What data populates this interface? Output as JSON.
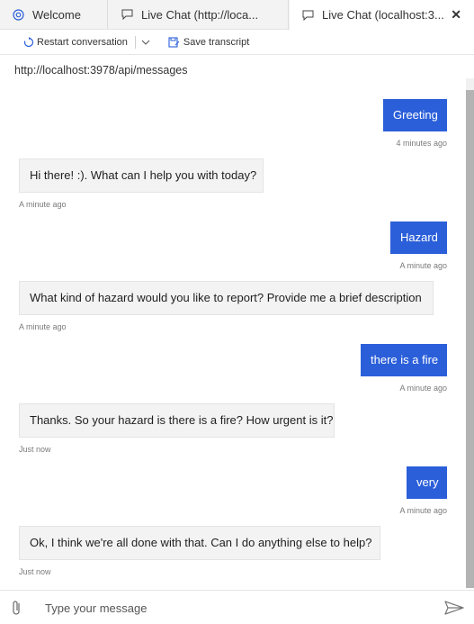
{
  "tabs": [
    {
      "label": "Welcome",
      "icon": "emulator-icon"
    },
    {
      "label": "Live Chat (http://loca...",
      "icon": "chat-icon"
    },
    {
      "label": "Live Chat (localhost:3...",
      "icon": "chat-icon",
      "active": true
    }
  ],
  "toolbar": {
    "restart_label": "Restart conversation",
    "save_label": "Save transcript"
  },
  "endpoint": "http://localhost:3978/api/messages",
  "messages": [
    {
      "from": "user",
      "text": "Greeting",
      "time": "4 minutes ago"
    },
    {
      "from": "bot",
      "text": "Hi there! :). What can I help you with today?",
      "time": "A minute ago"
    },
    {
      "from": "user",
      "text": "Hazard",
      "time": "A minute ago"
    },
    {
      "from": "bot",
      "text": "What kind of hazard would you like to report? Provide me a brief description",
      "time": "A minute ago"
    },
    {
      "from": "user",
      "text": "there is a fire",
      "time": "A minute ago"
    },
    {
      "from": "bot",
      "text": "Thanks. So your hazard is there is a fire? How urgent is it?",
      "time": "Just now"
    },
    {
      "from": "user",
      "text": "very",
      "time": "A minute ago"
    },
    {
      "from": "bot",
      "text": "Ok, I think we're all done with that. Can I do anything else to help?",
      "time": "Just now"
    }
  ],
  "composer": {
    "placeholder": "Type your message"
  },
  "colors": {
    "user_bubble": "#2b5fd9",
    "bot_bubble": "#f3f3f3"
  }
}
